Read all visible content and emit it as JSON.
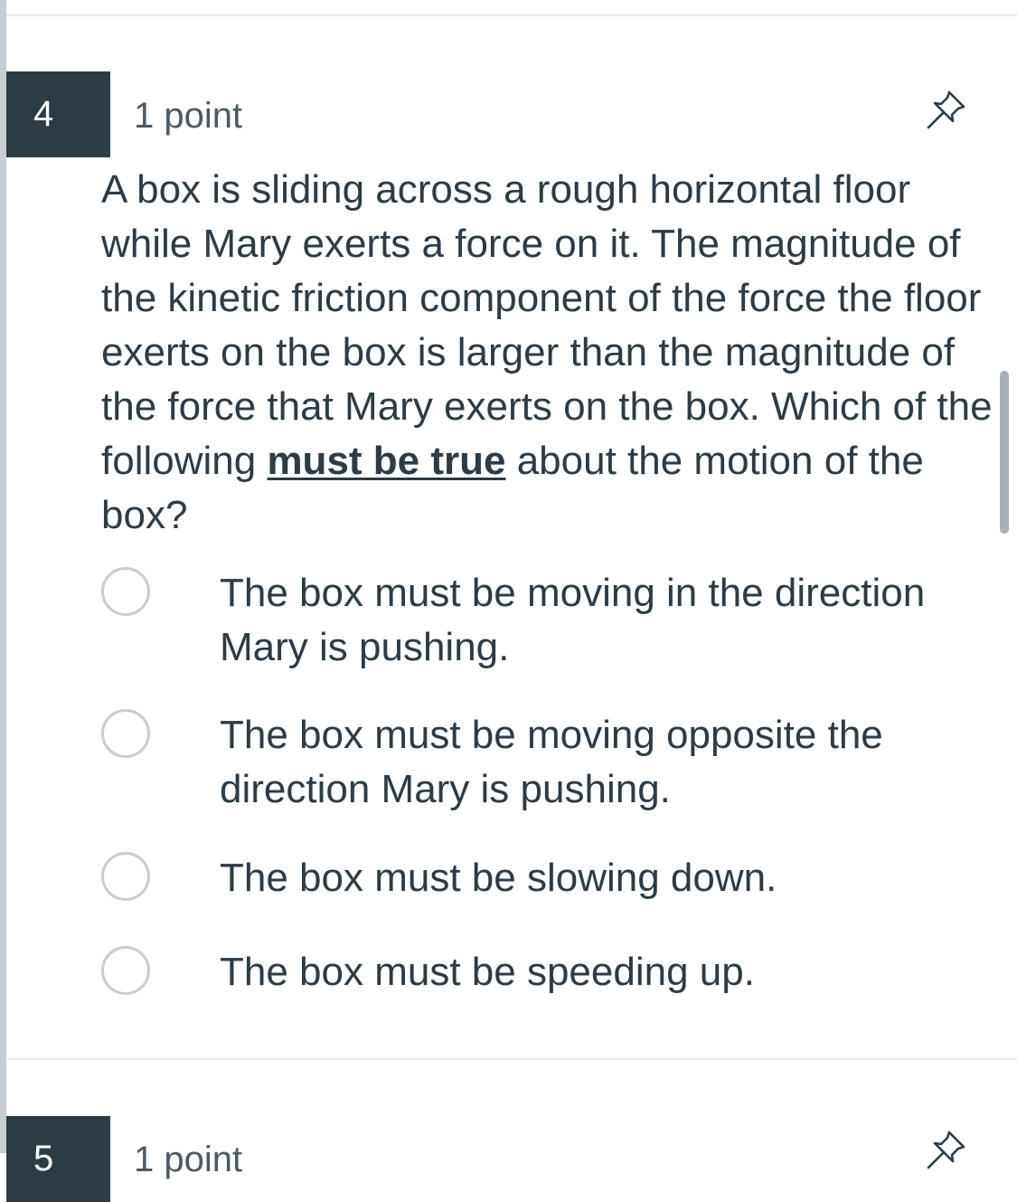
{
  "question": {
    "number": "4",
    "points": "1 point",
    "stem_before": "A box is sliding across a rough horizontal floor while Mary exerts a force on it. The magnitude of the kinetic friction component of the force the floor exerts on the box is larger than the magnitude of the force that Mary exerts on the box. Which of the following ",
    "stem_emphasis": "must be true",
    "stem_after": " about the motion of the box?",
    "answers": [
      {
        "label": "The box must be moving in the direction Mary is pushing.",
        "selected": false
      },
      {
        "label": "The box must be moving opposite the direction Mary is pushing.",
        "selected": false
      },
      {
        "label": "The box must be slowing down.",
        "selected": false
      },
      {
        "label": "The box must be speeding up.",
        "selected": false
      }
    ]
  },
  "next_question": {
    "number": "5",
    "points": "1 point"
  },
  "icons": {
    "pin": "pin-icon"
  },
  "colors": {
    "text": "#2d3b45",
    "number_badge_bg": "#2d3b45",
    "radio_border": "#c7cdd1",
    "divider": "#e8eaec",
    "left_rail": "#c7cdd1"
  }
}
